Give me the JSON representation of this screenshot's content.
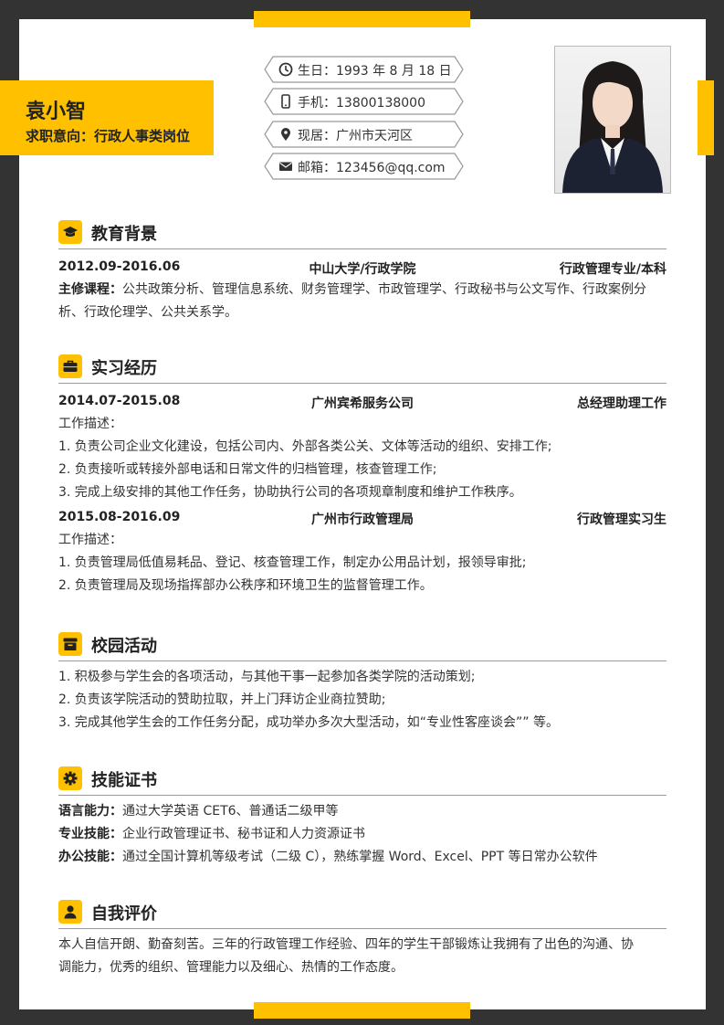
{
  "header": {
    "name": "袁小智",
    "intent": "求职意向：行政人事类岗位",
    "info": [
      {
        "icon": "clock-icon",
        "text": "生日：1993 年 8 月 18 日"
      },
      {
        "icon": "phone-icon",
        "text": "手机：13800138000"
      },
      {
        "icon": "location-pin-icon",
        "text": "现居：广州市天河区"
      },
      {
        "icon": "mail-icon",
        "text": "邮箱：123456@qq.com"
      }
    ]
  },
  "education": {
    "title": "教育背景",
    "period": "2012.09-2016.06",
    "school": "中山大学/行政学院",
    "major": "行政管理专业/本科",
    "courses_label": "主修课程：",
    "courses_line1": "公共政策分析、管理信息系统、财务管理学、市政管理学、行政秘书与公文写作、行政案例分",
    "courses_line2": "析、行政伦理学、公共关系学。"
  },
  "internship": {
    "title": "实习经历",
    "jobs": [
      {
        "period": "2014.07-2015.08",
        "company": "广州宾希服务公司",
        "role": "总经理助理工作",
        "desc_label": "工作描述：",
        "items": [
          "1. 负责公司企业文化建设，包括公司内、外部各类公关、文体等活动的组织、安排工作;",
          "2. 负责接听或转接外部电话和日常文件的归档管理，核查管理工作;",
          "3. 完成上级安排的其他工作任务，协助执行公司的各项规章制度和维护工作秩序。"
        ]
      },
      {
        "period": "2015.08-2016.09",
        "company": "广州市行政管理局",
        "role": "行政管理实习生",
        "desc_label": "工作描述：",
        "items": [
          "1. 负责管理局低值易耗品、登记、核查管理工作，制定办公用品计划，报领导审批;",
          "2. 负责管理局及现场指挥部办公秩序和环境卫生的监督管理工作。"
        ]
      }
    ]
  },
  "campus": {
    "title": "校园活动",
    "items": [
      "1. 积极参与学生会的各项活动，与其他干事一起参加各类学院的活动策划;",
      "2. 负责该学院活动的赞助拉取，并上门拜访企业商拉赞助;",
      "3. 完成其他学生会的工作任务分配，成功举办多次大型活动，如“专业性客座谈会”” 等。"
    ]
  },
  "skills": {
    "title": "技能证书",
    "items": [
      {
        "label": "语言能力：",
        "text": "通过大学英语 CET6、普通话二级甲等"
      },
      {
        "label": "专业技能：",
        "text": "企业行政管理证书、秘书证和人力资源证书"
      },
      {
        "label": "办公技能：",
        "text": "通过全国计算机等级考试（二级 C），熟练掌握 Word、Excel、PPT 等日常办公软件"
      }
    ]
  },
  "self_eval": {
    "title": "自我评价",
    "line1": "本人自信开朗、勤奋刻苦。三年的行政管理工作经验、四年的学生干部锻炼让我拥有了出色的沟通、协",
    "line2": "调能力，优秀的组织、管理能力以及细心、热情的工作态度。"
  },
  "colors": {
    "accent": "#FFC000",
    "frame": "#333333"
  }
}
